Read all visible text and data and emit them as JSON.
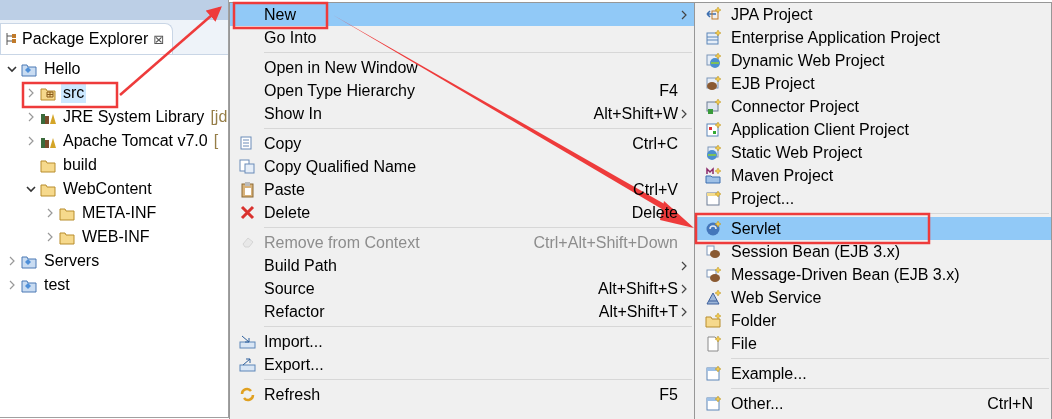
{
  "explorer": {
    "title": "Package Explorer",
    "close": "⊠",
    "tree": [
      {
        "label": "Hello",
        "kind": "project",
        "expanded": true,
        "selected": false,
        "children": [
          {
            "label": "src",
            "kind": "source-folder",
            "expanded": false,
            "selected": true
          },
          {
            "label": "JRE System Library",
            "decoration": "[jd",
            "kind": "library",
            "expanded": false,
            "selected": false
          },
          {
            "label": "Apache Tomcat v7.0",
            "decoration": "[",
            "kind": "library",
            "expanded": false,
            "selected": false
          },
          {
            "label": "build",
            "kind": "folder",
            "selected": false
          },
          {
            "label": "WebContent",
            "kind": "folder",
            "expanded": true,
            "selected": false,
            "children": [
              {
                "label": "META-INF",
                "kind": "folder",
                "expanded": false,
                "selected": false
              },
              {
                "label": "WEB-INF",
                "kind": "folder",
                "expanded": false,
                "selected": false
              }
            ]
          }
        ]
      },
      {
        "label": "Servers",
        "kind": "project",
        "expanded": false,
        "selected": false
      },
      {
        "label": "test",
        "kind": "project",
        "expanded": false,
        "selected": false
      }
    ]
  },
  "context_menu": {
    "items": [
      {
        "kind": "item",
        "label": "New",
        "submenu": true,
        "selected": true,
        "disabled": false
      },
      {
        "kind": "item",
        "label": "Go Into",
        "submenu": false,
        "selected": false,
        "disabled": false
      },
      {
        "kind": "separator"
      },
      {
        "kind": "item",
        "label": "Open in New Window",
        "submenu": false,
        "selected": false,
        "disabled": false
      },
      {
        "kind": "item",
        "label": "Open Type Hierarchy",
        "shortcut": "F4",
        "submenu": false,
        "selected": false,
        "disabled": false
      },
      {
        "kind": "item",
        "label": "Show In",
        "shortcut": "Alt+Shift+W",
        "submenu": true,
        "selected": false,
        "disabled": false
      },
      {
        "kind": "separator"
      },
      {
        "kind": "item",
        "label": "Copy",
        "shortcut": "Ctrl+C",
        "submenu": false,
        "selected": false,
        "disabled": false
      },
      {
        "kind": "item",
        "label": "Copy Qualified Name",
        "submenu": false,
        "selected": false,
        "disabled": false
      },
      {
        "kind": "item",
        "label": "Paste",
        "shortcut": "Ctrl+V",
        "submenu": false,
        "selected": false,
        "disabled": false
      },
      {
        "kind": "item",
        "label": "Delete",
        "shortcut": "Delete",
        "submenu": false,
        "selected": false,
        "disabled": false
      },
      {
        "kind": "separator"
      },
      {
        "kind": "item",
        "label": "Remove from Context",
        "shortcut": "Ctrl+Alt+Shift+Down",
        "submenu": false,
        "selected": false,
        "disabled": true
      },
      {
        "kind": "item",
        "label": "Build Path",
        "submenu": true,
        "selected": false,
        "disabled": false
      },
      {
        "kind": "item",
        "label": "Source",
        "shortcut": "Alt+Shift+S",
        "submenu": true,
        "selected": false,
        "disabled": false
      },
      {
        "kind": "item",
        "label": "Refactor",
        "shortcut": "Alt+Shift+T",
        "submenu": true,
        "selected": false,
        "disabled": false
      },
      {
        "kind": "separator"
      },
      {
        "kind": "item",
        "label": "Import...",
        "submenu": false,
        "selected": false,
        "disabled": false
      },
      {
        "kind": "item",
        "label": "Export...",
        "submenu": false,
        "selected": false,
        "disabled": false
      },
      {
        "kind": "separator"
      },
      {
        "kind": "item",
        "label": "Refresh",
        "shortcut": "F5",
        "submenu": false,
        "selected": false,
        "disabled": false
      }
    ]
  },
  "new_submenu": {
    "items": [
      {
        "kind": "item",
        "label": "JPA Project",
        "selected": false
      },
      {
        "kind": "item",
        "label": "Enterprise Application Project",
        "selected": false
      },
      {
        "kind": "item",
        "label": "Dynamic Web Project",
        "selected": false
      },
      {
        "kind": "item",
        "label": "EJB Project",
        "selected": false
      },
      {
        "kind": "item",
        "label": "Connector Project",
        "selected": false
      },
      {
        "kind": "item",
        "label": "Application Client Project",
        "selected": false
      },
      {
        "kind": "item",
        "label": "Static Web Project",
        "selected": false
      },
      {
        "kind": "item",
        "label": "Maven Project",
        "selected": false
      },
      {
        "kind": "item",
        "label": "Project...",
        "selected": false
      },
      {
        "kind": "separator"
      },
      {
        "kind": "item",
        "label": "Servlet",
        "selected": true
      },
      {
        "kind": "item",
        "label": "Session Bean (EJB 3.x)",
        "selected": false
      },
      {
        "kind": "item",
        "label": "Message-Driven Bean (EJB 3.x)",
        "selected": false
      },
      {
        "kind": "item",
        "label": "Web Service",
        "selected": false
      },
      {
        "kind": "item",
        "label": "Folder",
        "selected": false
      },
      {
        "kind": "item",
        "label": "File",
        "selected": false
      },
      {
        "kind": "separator"
      },
      {
        "kind": "item",
        "label": "Example...",
        "selected": false
      },
      {
        "kind": "separator"
      },
      {
        "kind": "item",
        "label": "Other...",
        "shortcut": "Ctrl+N",
        "selected": false
      }
    ]
  }
}
